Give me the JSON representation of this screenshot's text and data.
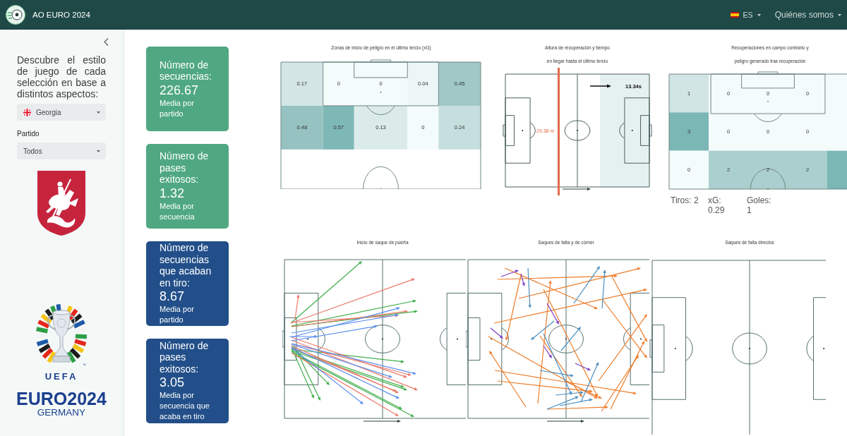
{
  "navbar": {
    "title": "AO EURO 2024",
    "language": "ES",
    "menu": "Quiénes somos"
  },
  "sidebar": {
    "intro": "Descubre el estilo de juego de cada selección en base a distintos aspectos:",
    "team_select": {
      "value": "Georgia"
    },
    "match_label": "Partido",
    "match_select": {
      "value": "Todos"
    },
    "tournament_logo": {
      "organizer": "UEFA",
      "name": "EURO2024",
      "host": "GERMANY",
      "trademark": "™"
    }
  },
  "stat_cards": [
    {
      "title": "Número de secuencias:",
      "value": "226.67",
      "caption": "Media por partido",
      "color": "#4fa882"
    },
    {
      "title": "Número de pases exitosos:",
      "value": "1.32",
      "caption": "Media por secuencia",
      "color": "#4fa882"
    },
    {
      "title": "Número de secuencias que acaban en tiro:",
      "value": "8.67",
      "caption": "Media por partido",
      "color": "#224f89"
    },
    {
      "title": "Número de pases exitosos:",
      "value": "3.05",
      "caption": "Media por secuencia que acaba en tiro",
      "color": "#224f89"
    }
  ],
  "top_charts": [
    {
      "kind": "zone_heatmap",
      "title_lines": [
        "Zonas de inicio de peligro en el último tercio (xG)"
      ],
      "cells": [
        [
          {
            "value": "0.17",
            "color": "#d3e6e5"
          },
          {
            "value": "0",
            "color": "#f4fbfb"
          },
          {
            "value": "0",
            "color": "#f4fbfb"
          },
          {
            "value": "0.04",
            "color": "#ecf6f6"
          },
          {
            "value": "0.45",
            "color": "#9fc8c7"
          }
        ],
        [
          {
            "value": "0.48",
            "color": "#96c3c2"
          },
          {
            "value": "0.57",
            "color": "#7db8b6"
          },
          {
            "value": "0.13",
            "color": "#dbebea"
          },
          {
            "value": "0",
            "color": "#f4fbfb"
          },
          {
            "value": "0.24",
            "color": "#c6dfde"
          }
        ]
      ]
    },
    {
      "kind": "recovery_height",
      "title_lines": [
        "Altura de recuperación y tiempo",
        "en llegar hasta el último tercio"
      ],
      "distance": "29.38 m",
      "time": "13.34s"
    },
    {
      "kind": "recovery_heatmap",
      "title_lines": [
        "Recuperaciones en campo contrario y",
        "peligro generado tras recuperación"
      ],
      "cells": [
        [
          {
            "value": "1",
            "color": "#d1e5e4"
          },
          {
            "value": "0",
            "color": "#f4fbfb"
          },
          {
            "value": "0",
            "color": "#f4fbfb"
          },
          {
            "value": "0",
            "color": "#f4fbfb"
          },
          {
            "color": "#f4fbfb"
          }
        ],
        [
          {
            "value": "3",
            "color": "#7ab7b5"
          },
          {
            "value": "0",
            "color": "#f4fbfb"
          },
          {
            "value": "0",
            "color": "#f4fbfb"
          },
          {
            "value": "0",
            "color": "#f4fbfb"
          },
          {
            "color": "#f4fbfb"
          }
        ],
        [
          {
            "value": "0",
            "color": "#f4fbfb"
          },
          {
            "value": "2",
            "color": "#abcfce"
          },
          {
            "value": "2",
            "color": "#abcfce"
          },
          {
            "value": "2",
            "color": "#abcfce"
          },
          {
            "color": "#7ab7b5"
          }
        ]
      ],
      "stats": [
        "Tiros: 2",
        "xG: 0.29",
        "Goles: 1"
      ]
    }
  ],
  "bottom_charts": [
    {
      "kind": "goal_kicks",
      "title": "Inicio de saque de puerta"
    },
    {
      "kind": "set_pieces",
      "title": "Saques de falta y de córner"
    },
    {
      "kind": "direct_free_kicks",
      "title": "Saques de falta directos"
    }
  ]
}
